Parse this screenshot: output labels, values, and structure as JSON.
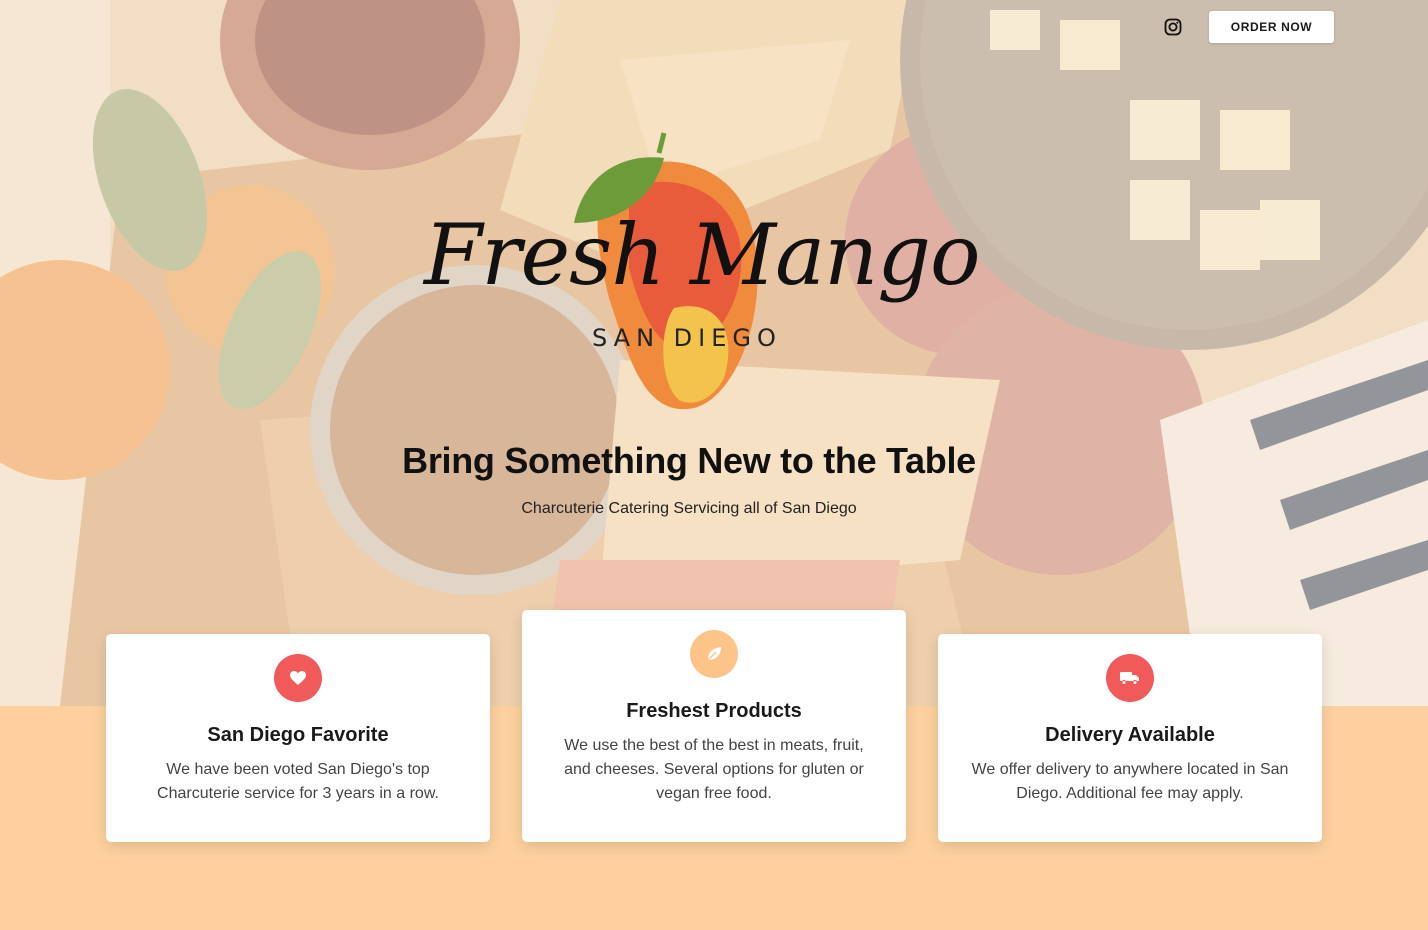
{
  "header": {
    "instagram_icon": "instagram-icon",
    "order_label": "ORDER NOW"
  },
  "logo": {
    "title": "Fresh Mango",
    "subtitle": "SAN DIEGO"
  },
  "hero": {
    "headline": "Bring Something New to the Table",
    "subheadline": "Charcuterie Catering Servicing all of San Diego"
  },
  "features": [
    {
      "icon": "heart-icon",
      "color": "#f25a5a",
      "title": "San Diego Favorite",
      "text": "We have been voted San Diego's top Charcuterie service for 3 years in a row."
    },
    {
      "icon": "leaf-icon",
      "color": "#fdc48a",
      "title": "Freshest Products",
      "text": "We use the best of the best in meats, fruit, and cheeses. Several options for gluten or vegan free food."
    },
    {
      "icon": "truck-icon",
      "color": "#f25a5a",
      "title": "Delivery Available",
      "text": "We offer delivery to anywhere located in San Diego. Additional fee may apply."
    }
  ],
  "colors": {
    "accent_red": "#f25a5a",
    "accent_peach": "#fdd09e"
  }
}
